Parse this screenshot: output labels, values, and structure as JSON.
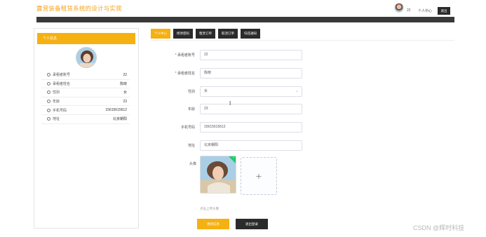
{
  "header": {
    "app_title": "露营装备租赁系统的设计与实现",
    "username": "22",
    "user_center_label": "个人中心",
    "logout_label": "退出"
  },
  "profile_card": {
    "title": "个人信息",
    "rows": [
      {
        "label": "承租者账号",
        "value": "22"
      },
      {
        "label": "承租者姓名",
        "value": "陈晓"
      },
      {
        "label": "性别",
        "value": "女"
      },
      {
        "label": "年龄",
        "value": "23"
      },
      {
        "label": "手机号码",
        "value": "15615615612"
      },
      {
        "label": "地址",
        "value": "北京朝阳"
      }
    ]
  },
  "tabs": [
    {
      "label": "个人中心",
      "active": true
    },
    {
      "label": "修改密码",
      "active": false
    },
    {
      "label": "租赁订单",
      "active": false
    },
    {
      "label": "取消订单",
      "active": false
    },
    {
      "label": "归还通知",
      "active": false
    }
  ],
  "form": {
    "account": {
      "label": "承租者账号",
      "value": "22",
      "required": true
    },
    "name": {
      "label": "承租者姓名",
      "value": "陈晓",
      "required": true
    },
    "gender": {
      "label": "性别",
      "value": "女"
    },
    "age": {
      "label": "年龄",
      "value": "23"
    },
    "phone": {
      "label": "手机号码",
      "value": "15615615612"
    },
    "address": {
      "label": "地址",
      "value": "北京朝阳"
    },
    "avatar": {
      "label": "头像",
      "hint": "点击上传头像"
    }
  },
  "buttons": {
    "save": "更新信息",
    "exit": "退出登录"
  },
  "watermark": "CSDN @辉时科技",
  "colors": {
    "accent": "#f5b011",
    "dark": "#2b2b2b",
    "title": "#f3a41b"
  }
}
